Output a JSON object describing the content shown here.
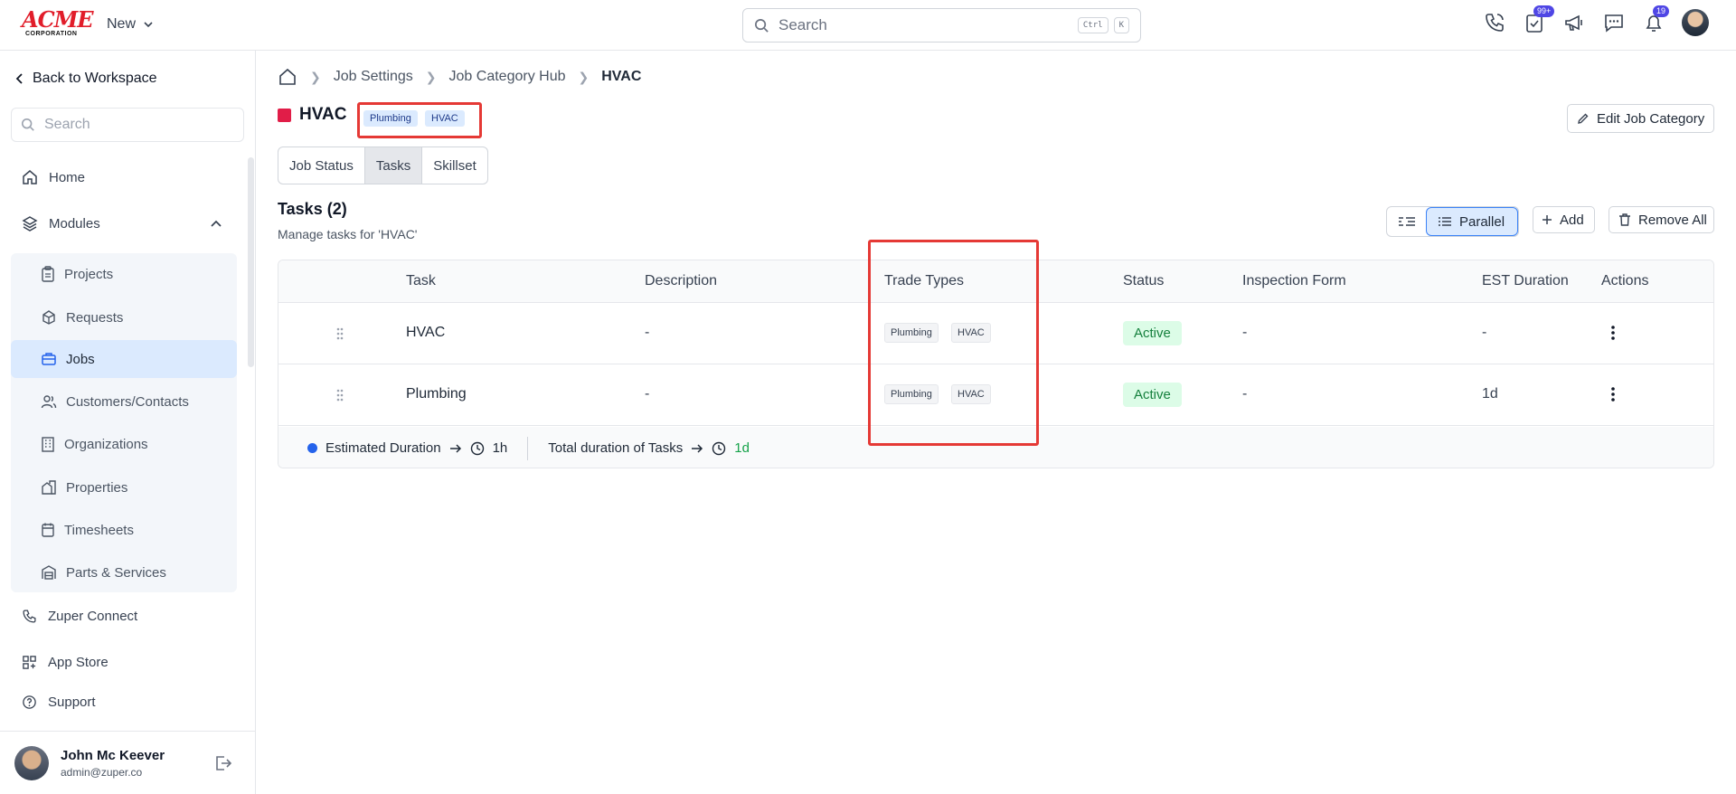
{
  "header": {
    "logo": {
      "brand": "ACME",
      "sub": "CORPORATION"
    },
    "new_label": "New",
    "search_placeholder": "Search",
    "kbd1": "Ctrl",
    "kbd2": "K",
    "badges": {
      "tasks": "99+",
      "notifications": "19"
    }
  },
  "sidebar": {
    "back_label": "Back to Workspace",
    "search_placeholder": "Search",
    "home": "Home",
    "modules": "Modules",
    "module_items": [
      {
        "label": "Projects",
        "icon": "clipboard-icon"
      },
      {
        "label": "Requests",
        "icon": "request-icon"
      },
      {
        "label": "Jobs",
        "icon": "briefcase-icon"
      },
      {
        "label": "Customers/Contacts",
        "icon": "users-icon"
      },
      {
        "label": "Organizations",
        "icon": "building-icon"
      },
      {
        "label": "Properties",
        "icon": "property-icon"
      },
      {
        "label": "Timesheets",
        "icon": "calendar-icon"
      },
      {
        "label": "Parts & Services",
        "icon": "warehouse-icon"
      }
    ],
    "zuper_connect": "Zuper Connect",
    "app_store": "App Store",
    "support": "Support",
    "user": {
      "name": "John Mc Keever",
      "email": "admin@zuper.co"
    }
  },
  "breadcrumb": {
    "c1": "Job Settings",
    "c2": "Job Category Hub",
    "c3": "HVAC"
  },
  "category": {
    "title": "HVAC",
    "color": "#e11d48",
    "tags": [
      "Plumbing",
      "HVAC"
    ],
    "edit_label": "Edit Job Category"
  },
  "tabs": {
    "t1": "Job Status",
    "t2": "Tasks",
    "t3": "Skillset"
  },
  "tasks_section": {
    "title": "Tasks (2)",
    "subtitle": "Manage tasks for 'HVAC'",
    "parallel_label": "Parallel",
    "add_label": "Add",
    "remove_all_label": "Remove All"
  },
  "table": {
    "headers": {
      "task": "Task",
      "description": "Description",
      "trade_types": "Trade Types",
      "status": "Status",
      "inspection_form": "Inspection Form",
      "est_duration": "EST Duration",
      "actions": "Actions"
    },
    "rows": [
      {
        "task": "HVAC",
        "description": "-",
        "trade1": "Plumbing",
        "trade2": "HVAC",
        "status": "Active",
        "inspection_form": "-",
        "est_duration": "-"
      },
      {
        "task": "Plumbing",
        "description": "-",
        "trade1": "Plumbing",
        "trade2": "HVAC",
        "status": "Active",
        "inspection_form": "-",
        "est_duration": "1d"
      }
    ],
    "footer": {
      "est_label": "Estimated Duration",
      "est_value": "1h",
      "total_label": "Total duration of Tasks",
      "total_value": "1d"
    }
  }
}
